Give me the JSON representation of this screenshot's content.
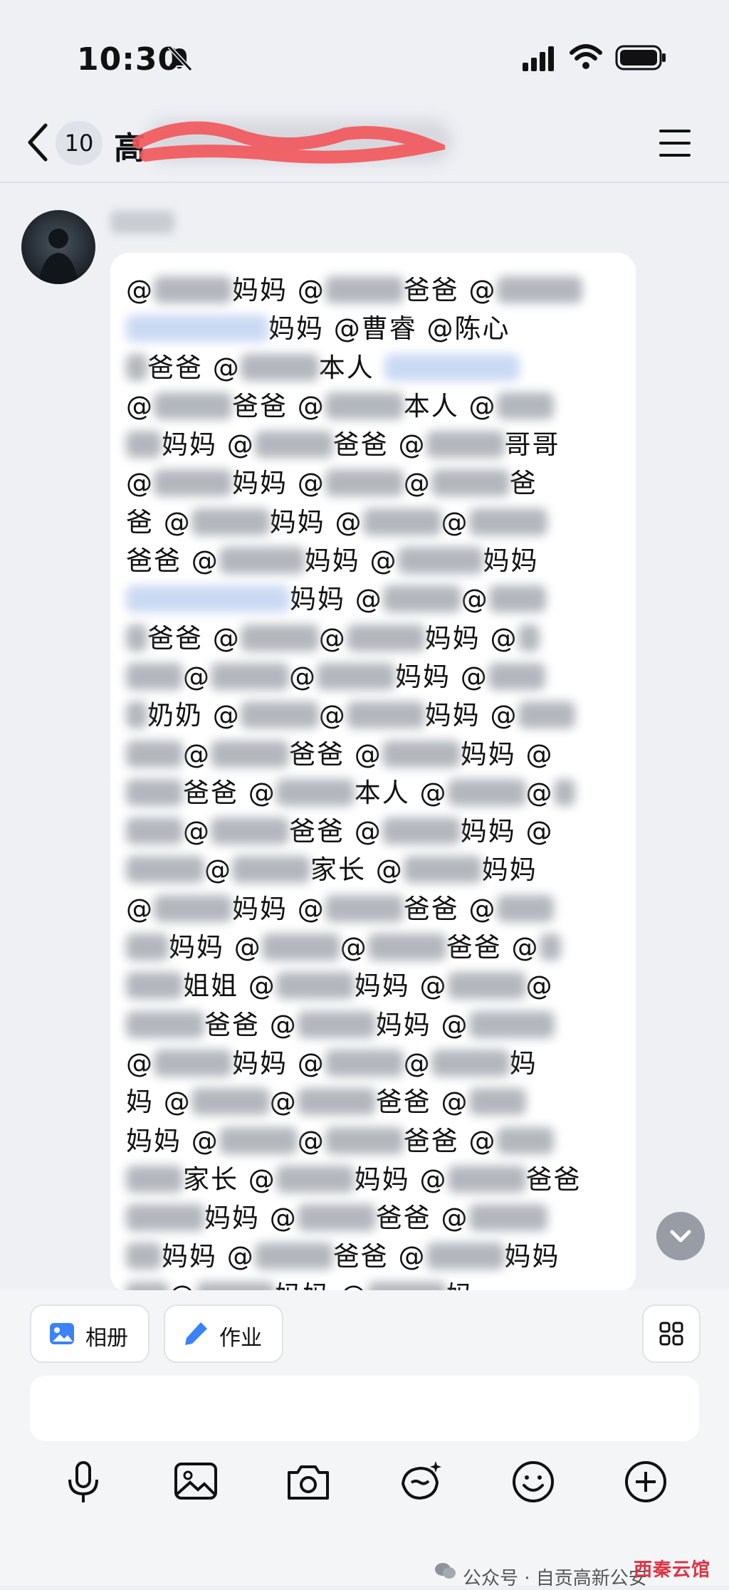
{
  "status": {
    "time": "10:30"
  },
  "nav": {
    "unread_count": "10",
    "title_prefix": "高"
  },
  "message": {
    "lines": [
      [
        "@",
        {
          "blur": 110
        },
        "妈妈 @",
        {
          "blur": 110
        },
        "爸爸 @",
        {
          "blur": 120
        }
      ],
      [
        {
          "blur": 200,
          "link": true
        },
        "妈妈 @曹睿 @陈心"
      ],
      [
        {
          "blur": 30
        },
        "爸爸 @",
        {
          "blur": 110
        },
        "本人 ",
        {
          "blur": 190,
          "link": true
        }
      ],
      [
        "@",
        {
          "blur": 110
        },
        "爸爸 @",
        {
          "blur": 110
        },
        "本人 @",
        {
          "blur": 80
        }
      ],
      [
        {
          "blur": 50
        },
        "妈妈 @",
        {
          "blur": 110
        },
        "爸爸 @",
        {
          "blur": 110
        },
        "哥哥"
      ],
      [
        "@",
        {
          "blur": 110
        },
        "妈妈 @",
        {
          "blur": 110
        },
        "@",
        {
          "blur": 110
        },
        "爸"
      ],
      [
        "爸 @",
        {
          "blur": 110
        },
        "妈妈 @",
        {
          "blur": 110
        },
        "@",
        {
          "blur": 110
        }
      ],
      [
        "爸爸 @",
        {
          "blur": 120
        },
        "妈妈 @",
        {
          "blur": 120
        },
        "妈妈"
      ],
      [
        {
          "blur": 230,
          "link": true
        },
        "妈妈 @",
        {
          "blur": 110
        },
        "@",
        {
          "blur": 80
        }
      ],
      [
        {
          "blur": 30
        },
        "爸爸 @",
        {
          "blur": 110
        },
        "@",
        {
          "blur": 110
        },
        "妈妈 @",
        {
          "blur": 30
        }
      ],
      [
        {
          "blur": 80
        },
        "@",
        {
          "blur": 110
        },
        "@",
        {
          "blur": 110
        },
        "妈妈 @",
        {
          "blur": 80
        }
      ],
      [
        {
          "blur": 30
        },
        "奶奶 @",
        {
          "blur": 110
        },
        "@",
        {
          "blur": 110
        },
        "妈妈 @",
        {
          "blur": 80
        }
      ],
      [
        {
          "blur": 80
        },
        "@",
        {
          "blur": 110
        },
        "爸爸 @",
        {
          "blur": 110
        },
        "妈妈 @"
      ],
      [
        {
          "blur": 80
        },
        "爸爸 @",
        {
          "blur": 110
        },
        "本人 @",
        {
          "blur": 110
        },
        "@",
        {
          "blur": 30
        }
      ],
      [
        {
          "blur": 80
        },
        "@",
        {
          "blur": 110
        },
        "爸爸 @",
        {
          "blur": 110
        },
        "妈妈 @"
      ],
      [
        {
          "blur": 110
        },
        "@",
        {
          "blur": 110
        },
        "家长 @",
        {
          "blur": 110
        },
        "妈妈"
      ],
      [
        "@",
        {
          "blur": 110
        },
        "妈妈 @",
        {
          "blur": 110
        },
        "爸爸 @",
        {
          "blur": 80
        }
      ],
      [
        {
          "blur": 60
        },
        "妈妈 @",
        {
          "blur": 110
        },
        "@",
        {
          "blur": 110
        },
        "爸爸 @",
        {
          "blur": 30
        }
      ],
      [
        {
          "blur": 80
        },
        "姐姐 @",
        {
          "blur": 110
        },
        "妈妈 @",
        {
          "blur": 110
        },
        "@"
      ],
      [
        {
          "blur": 110
        },
        "爸爸 @",
        {
          "blur": 110
        },
        "妈妈 @",
        {
          "blur": 120
        }
      ],
      [
        "@",
        {
          "blur": 110
        },
        "妈妈 @",
        {
          "blur": 110
        },
        "@",
        {
          "blur": 110
        },
        "妈"
      ],
      [
        "妈 @",
        {
          "blur": 110
        },
        "@",
        {
          "blur": 110
        },
        "爸爸 @",
        {
          "blur": 80
        }
      ],
      [
        "妈妈 @",
        {
          "blur": 110
        },
        "@",
        {
          "blur": 110
        },
        "爸爸 @",
        {
          "blur": 80
        }
      ],
      [
        {
          "blur": 80
        },
        "家长 @",
        {
          "blur": 110
        },
        "妈妈 @",
        {
          "blur": 110
        },
        "爸爸"
      ],
      [
        {
          "blur": 110
        },
        "妈妈 @",
        {
          "blur": 110
        },
        "爸爸 @",
        {
          "blur": 110
        }
      ],
      [
        {
          "blur": 50
        },
        "妈妈 @",
        {
          "blur": 110
        },
        "爸爸 @",
        {
          "blur": 110
        },
        "妈妈"
      ],
      [
        {
          "blur": 60
        },
        "@",
        {
          "blur": 110
        },
        "妈妈 @",
        {
          "blur": 110
        },
        "妈"
      ]
    ]
  },
  "actions": {
    "album_label": "相册",
    "homework_label": "作业"
  },
  "toolbar_icons": [
    "microphone-icon",
    "image-icon",
    "camera-icon",
    "sticker-icon",
    "emoji-icon",
    "plus-icon"
  ],
  "watermark": {
    "text": "公众号 · 自贡高新公安",
    "brand": "西秦云馆"
  },
  "colors": {
    "accent": "#3b82f6",
    "background": "#eef0f4"
  }
}
